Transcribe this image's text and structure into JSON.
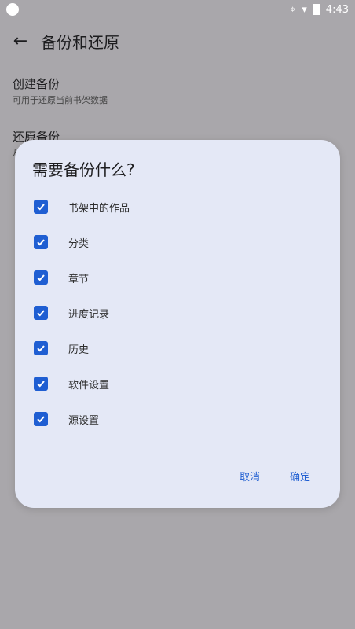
{
  "status": {
    "time": "4:43"
  },
  "appbar": {
    "title": "备份和还原"
  },
  "settings": {
    "items": [
      {
        "title": "创建备份",
        "subtitle": "可用于还原当前书架数据"
      },
      {
        "title": "还原备份",
        "subtitle": "从"
      }
    ]
  },
  "dialog": {
    "title": "需要备份什么?",
    "options": [
      {
        "label": "书架中的作品",
        "checked": true
      },
      {
        "label": "分类",
        "checked": true
      },
      {
        "label": "章节",
        "checked": true
      },
      {
        "label": "进度记录",
        "checked": true
      },
      {
        "label": "历史",
        "checked": true
      },
      {
        "label": "软件设置",
        "checked": true
      },
      {
        "label": "源设置",
        "checked": true
      }
    ],
    "cancel_label": "取消",
    "ok_label": "确定"
  },
  "colors": {
    "accent": "#1f5ed2",
    "dialog_bg": "#e4e8f6",
    "scrim_bg": "#a9a7ab"
  }
}
